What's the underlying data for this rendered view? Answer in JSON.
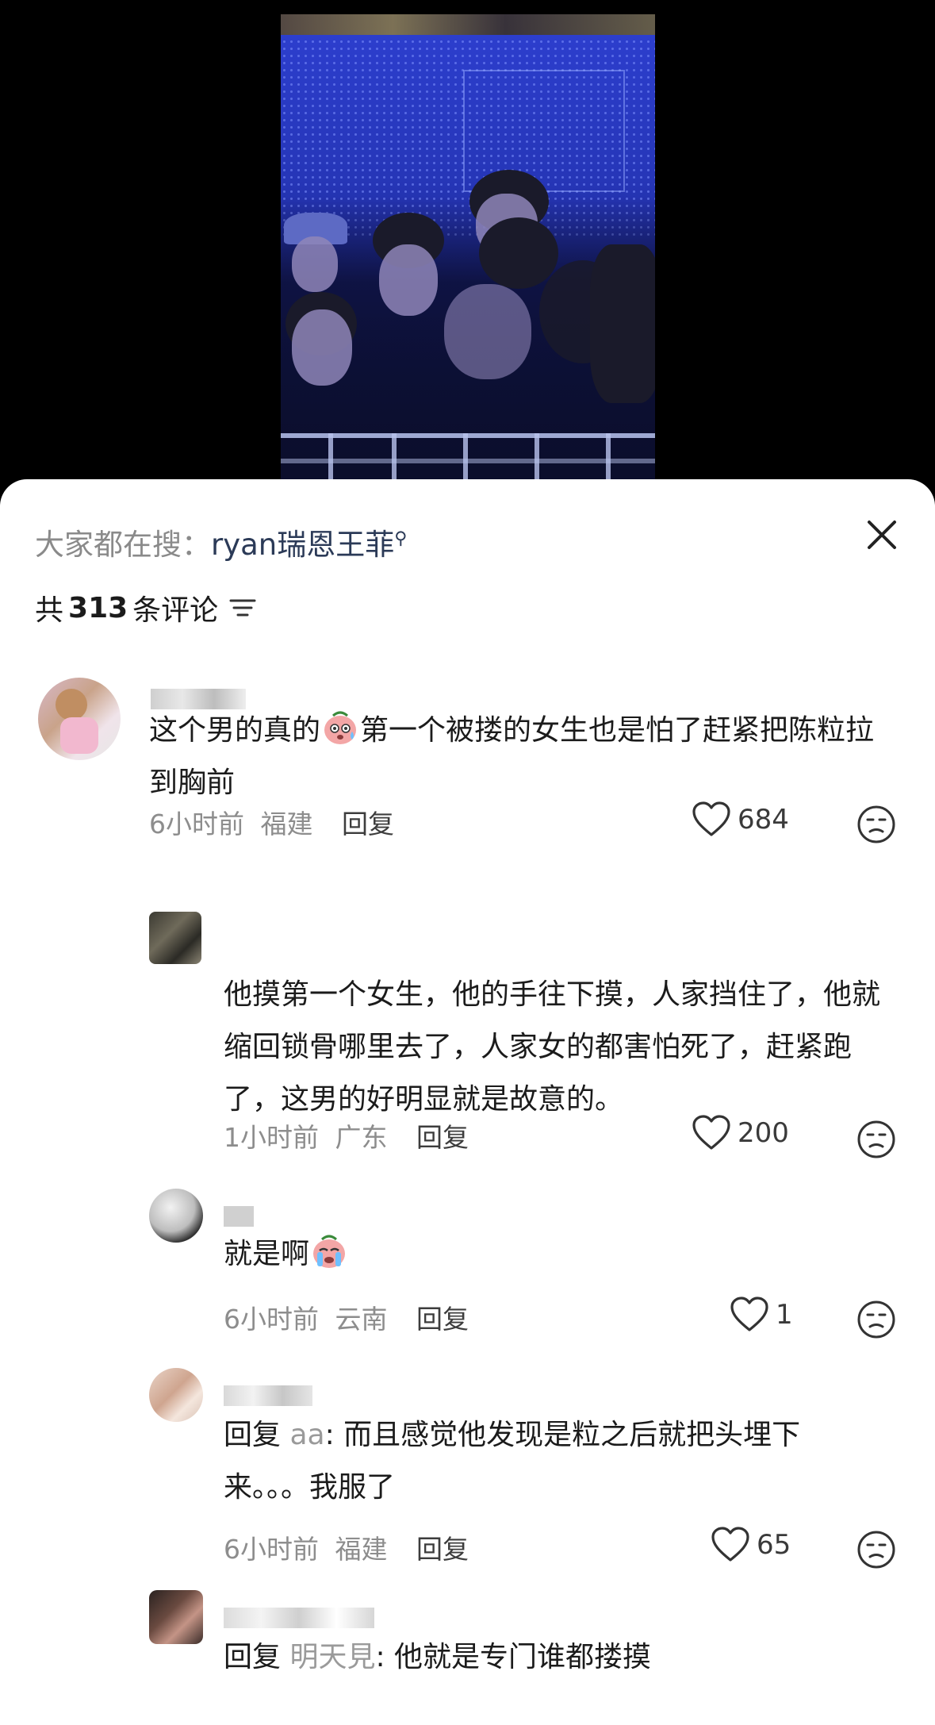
{
  "search": {
    "prefix": "大家都在搜：",
    "keyword": "ryan瑞恩王菲",
    "icon": "search-icon"
  },
  "header": {
    "count_prefix": "共",
    "count": "313",
    "count_suffix": "条评论",
    "sort_icon": "sort-icon"
  },
  "close_icon": "close-icon",
  "comments": [
    {
      "text_a": "这个男的真的",
      "emoji": "scared-face-emoji",
      "text_b": "第一个被搂的女生也是怕了赶紧把陈粒拉到胸前",
      "time": "6小时前",
      "location": "福建",
      "reply_label": "回复",
      "likes": "684"
    },
    {
      "text": "他摸第一个女生，他的手往下摸，人家挡住了，他就缩回锁骨哪里去了，人家女的都害怕死了，赶紧跑了，这男的好明显就是故意的。",
      "time": "1小时前",
      "location": "广东",
      "reply_label": "回复",
      "likes": "200"
    },
    {
      "text_a": "就是啊",
      "emoji": "crying-face-emoji",
      "time": "6小时前",
      "location": "云南",
      "reply_label": "回复",
      "likes": "1"
    },
    {
      "reply_prefix": "回复",
      "mention": "aa",
      "text": ": 而且感觉他发现是粒之后就把头埋下来。。。我服了",
      "time": "6小时前",
      "location": "福建",
      "reply_label": "回复",
      "likes": "65"
    },
    {
      "reply_prefix": "回复",
      "mention": "明天見",
      "text": ": 他就是专门谁都搂摸"
    }
  ],
  "colors": {
    "accent": "#2b3a57",
    "meta": "#8d8d8d",
    "video_blue": "#2636b8"
  }
}
